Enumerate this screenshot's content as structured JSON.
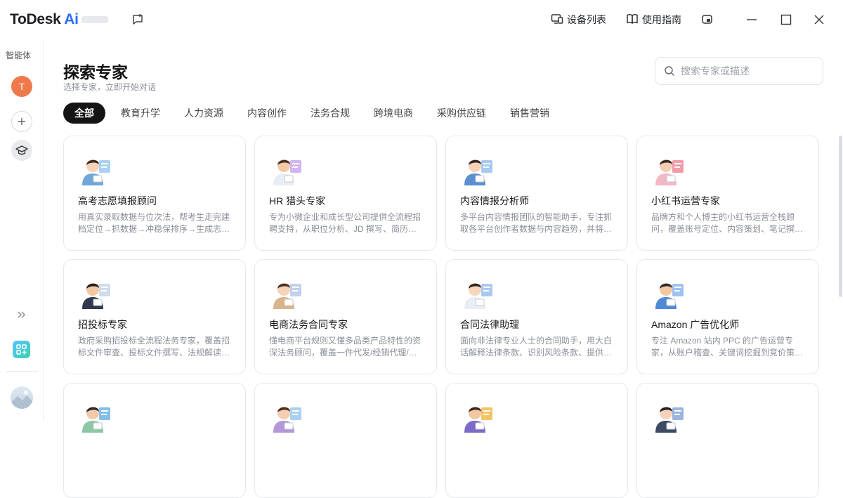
{
  "app": {
    "brand_main": "ToDesk",
    "brand_ai": "Ai"
  },
  "toolbar": {
    "device_list": "设备列表",
    "guide": "使用指南"
  },
  "sidebar": {
    "label": "智能体",
    "avatar_letter": "T"
  },
  "page": {
    "title": "探索专家",
    "subtitle": "选择专家，立即开始对话"
  },
  "search": {
    "placeholder": "搜索专家或描述"
  },
  "tabs": [
    "全部",
    "教育升学",
    "人力资源",
    "内容创作",
    "法务合规",
    "跨境电商",
    "采购供应链",
    "销售营销"
  ],
  "cards": [
    {
      "name": "高考志愿填报顾问",
      "desc": "用真实录取数据与位次法，帮考生走完建档定位→抓数据→冲稳保排序→生成志愿表的全流程。",
      "icon": "graduate-advisor-avatar"
    },
    {
      "name": "HR 猎头专家",
      "desc": "专为小微企业和成长型公司提供全流程招聘支持，从职位分析、JD 撰写、简历筛选到面试评估。",
      "icon": "hr-headhunter-avatar"
    },
    {
      "name": "内容情报分析师",
      "desc": "多平台内容情报团队的智能助手，专注抓取各平台创作者数据与内容趋势，并将其整理成报告。",
      "icon": "content-analyst-avatar"
    },
    {
      "name": "小红书运营专家",
      "desc": "品牌方和个人博主的小红书运营全栈顾问，覆盖账号定位、内容策划、笔记撰写与数据复盘。",
      "icon": "xiaohongshu-operator-avatar"
    },
    {
      "name": "招投标专家",
      "desc": "政府采购招投标全流程法务专家，覆盖招标文件审查、投标文件撰写、法规解读与风险提示。",
      "icon": "bidding-expert-avatar"
    },
    {
      "name": "电商法务合同专家",
      "desc": "懂电商平台规则又懂多品类产品特性的资深法务顾问，覆盖一件代发/经销代理/品牌授权合同。",
      "icon": "ecommerce-legal-avatar"
    },
    {
      "name": "合同法律助理",
      "desc": "面向非法律专业人士的合同助手，用大白话解释法律条款、识别风险条款、提供修改建议。",
      "icon": "contract-assistant-avatar"
    },
    {
      "name": "Amazon 广告优化师",
      "desc": "专注 Amazon 站内 PPC 的广告运营专家，从账户稽查、关键词挖掘到竞价策略全面优化。",
      "icon": "amazon-ads-avatar"
    },
    {
      "name": "",
      "desc": "",
      "icon": "global-trade-avatar"
    },
    {
      "name": "",
      "desc": "",
      "icon": "research-analyst-avatar"
    },
    {
      "name": "",
      "desc": "",
      "icon": "supply-chain-avatar"
    },
    {
      "name": "",
      "desc": "",
      "icon": "sales-strategist-avatar"
    }
  ],
  "colors": {
    "brand_ai": "#2b6cf6",
    "avatar_bg": "#ee7a4b",
    "active_tab_bg": "#141414"
  }
}
